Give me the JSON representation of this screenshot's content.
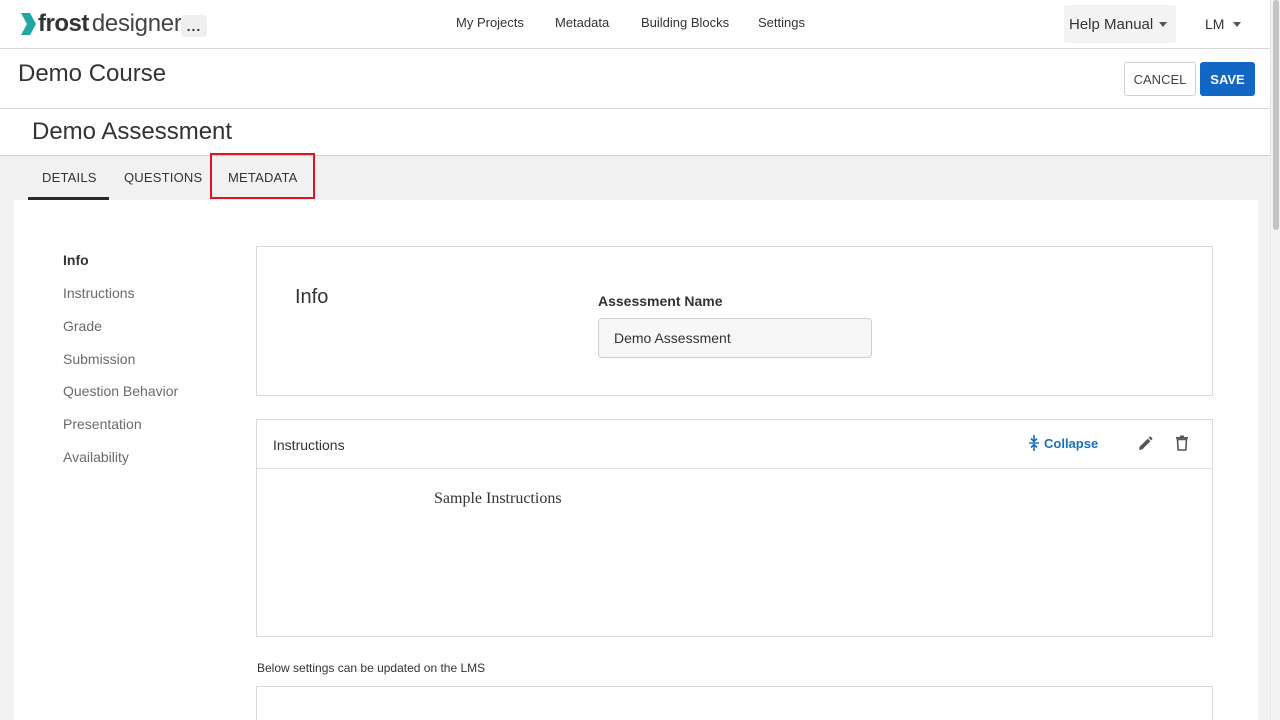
{
  "header": {
    "logo_word_1": "frost",
    "logo_word_2": "designer",
    "more_label": "...",
    "nav": [
      {
        "label": "My Projects"
      },
      {
        "label": "Metadata"
      },
      {
        "label": "Building Blocks"
      },
      {
        "label": "Settings"
      }
    ],
    "help_label": "Help Manual",
    "user_initials": "LM",
    "logo_color": "#1fa8a0"
  },
  "course": {
    "title": "Demo Course",
    "cancel_label": "CANCEL",
    "save_label": "SAVE",
    "save_color": "#1266c4"
  },
  "assessment": {
    "title": "Demo Assessment"
  },
  "tabs": [
    {
      "label": "DETAILS",
      "active": true
    },
    {
      "label": "QUESTIONS",
      "active": false
    },
    {
      "label": "METADATA",
      "active": false,
      "highlighted": true
    }
  ],
  "sidebar": {
    "items": [
      {
        "label": "Info",
        "active": true
      },
      {
        "label": "Instructions"
      },
      {
        "label": "Grade"
      },
      {
        "label": "Submission"
      },
      {
        "label": "Question Behavior"
      },
      {
        "label": "Presentation"
      },
      {
        "label": "Availability"
      }
    ]
  },
  "info": {
    "heading": "Info",
    "field_label": "Assessment Name",
    "field_value": "Demo Assessment"
  },
  "instructions": {
    "title": "Instructions",
    "collapse_label": "Collapse",
    "body": "Sample Instructions",
    "accent_color": "#1a6fc0"
  },
  "lms_note": "Below settings can be updated on the LMS",
  "highlight_color": "#e0141e"
}
